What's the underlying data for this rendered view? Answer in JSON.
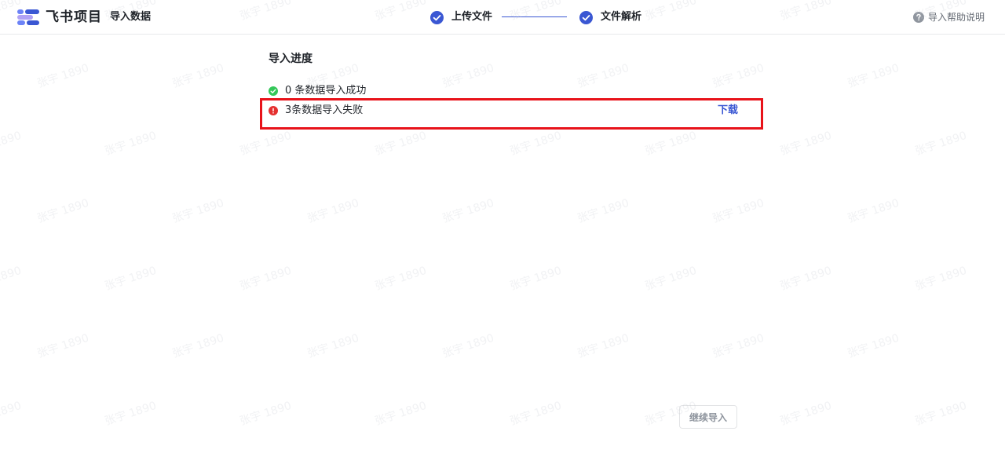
{
  "header": {
    "brand": "飞书项目",
    "page_name": "导入数据",
    "steps": [
      {
        "label": "上传文件",
        "status": "done"
      },
      {
        "label": "文件解析",
        "status": "done"
      }
    ],
    "help_label": "导入帮助说明"
  },
  "progress": {
    "title": "导入进度",
    "success_text": "0 条数据导入成功",
    "fail_text": "3条数据导入失败",
    "download_label": "下载"
  },
  "footer": {
    "continue_label": "继续导入"
  },
  "watermark": {
    "text": "张宇 1890"
  },
  "colors": {
    "accent": "#3a57d3",
    "success": "#34c759",
    "error": "#e5302f",
    "highlight": "#e8131a"
  }
}
